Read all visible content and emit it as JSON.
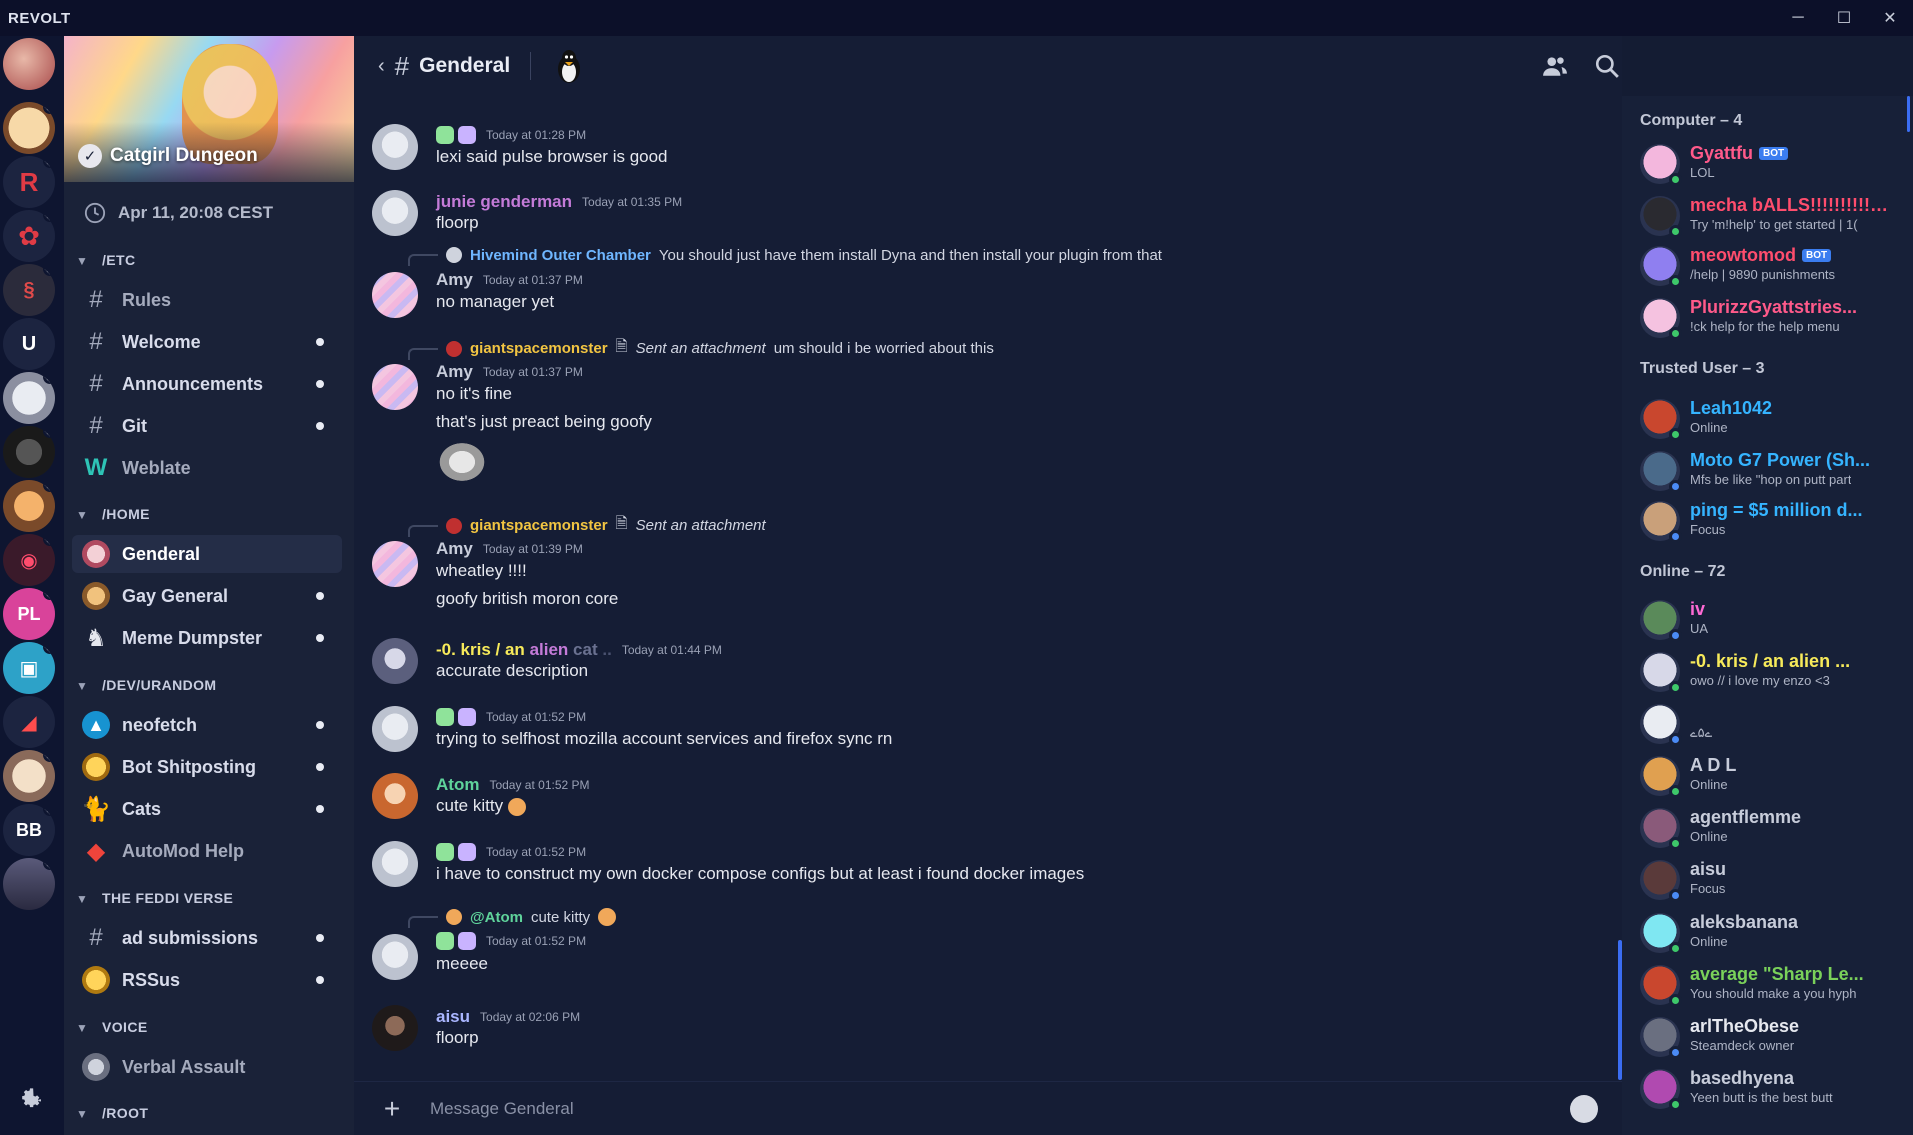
{
  "window": {
    "app_name": "REVOLT",
    "minimize": "─",
    "maximize": "☐",
    "close": "✕"
  },
  "server": {
    "name": "Catgirl Dungeon",
    "verified_mark": "✓",
    "time_label": "Apr 11, 20:08 CEST",
    "categories": [
      {
        "label": "/ETC"
      },
      {
        "label": "/HOME"
      },
      {
        "label": "/DEV/URANDOM"
      },
      {
        "label": "THE FEDDI VERSE"
      },
      {
        "label": "VOICE"
      },
      {
        "label": "/ROOT"
      }
    ],
    "channels": [
      {
        "label": "Rules",
        "icon": "hash-icon"
      },
      {
        "label": "Welcome",
        "icon": "hash-icon"
      },
      {
        "label": "Announcements",
        "icon": "hash-icon"
      },
      {
        "label": "Git",
        "icon": "hash-icon"
      },
      {
        "label": "Weblate",
        "icon": "weblate-icon"
      },
      {
        "label": "Genderal",
        "icon": "channel-avatar"
      },
      {
        "label": "Gay General",
        "icon": "channel-avatar"
      },
      {
        "label": "Meme Dumpster",
        "icon": "channel-avatar"
      },
      {
        "label": "neofetch",
        "icon": "arch-icon"
      },
      {
        "label": "Bot Shitposting",
        "icon": "channel-avatar"
      },
      {
        "label": "Cats",
        "icon": "cat-icon"
      },
      {
        "label": "AutoMod Help",
        "icon": "anydesk-icon"
      },
      {
        "label": "ad submissions",
        "icon": "hash-icon"
      },
      {
        "label": "RSSus",
        "icon": "channel-avatar"
      },
      {
        "label": "Verbal Assault",
        "icon": "voice-avatar"
      }
    ],
    "rail": [
      {
        "label": "R",
        "color": "#d9343d"
      },
      {
        "label": "U",
        "color": "#1c2440"
      },
      {
        "label": "PL",
        "color": "#d9439a"
      },
      {
        "label": "BB",
        "color": "#1c2440"
      }
    ],
    "settings_icon": "gear-icon"
  },
  "channel_header": {
    "back": "‹",
    "hash": "#",
    "name": "Genderal"
  },
  "messages": [
    {
      "author": "",
      "time": "Today at 01:28 PM",
      "lines": [
        "lexi said pulse browser is good"
      ]
    },
    {
      "author": "junie genderman",
      "time": "Today at 01:35 PM",
      "lines": [
        "floorp"
      ]
    },
    {
      "reply_to": "Hivemind Outer Chamber",
      "reply_text": "You should just have them install Dyna and then install your plugin from that",
      "author": "Amy",
      "time": "Today at 01:37 PM",
      "lines": [
        "no manager yet"
      ]
    },
    {
      "reply_to": "giantspacemonster",
      "reply_attachment": "Sent an attachment",
      "reply_text": "um should i be worried about this",
      "author": "Amy",
      "time": "Today at 01:37 PM",
      "lines": [
        "no it's fine",
        "that's just preact being goofy"
      ]
    },
    {
      "reply_to": "giantspacemonster",
      "reply_attachment": "Sent an attachment",
      "author": "Amy",
      "time": "Today at 01:39 PM",
      "lines": [
        "wheatley !!!!",
        "goofy british moron core"
      ]
    },
    {
      "author_a": "-0. kris / an",
      "author_b": "alien",
      "author_c": "cat",
      "author_d": "..",
      "time": "Today at 01:44 PM",
      "lines": [
        "accurate description"
      ]
    },
    {
      "author": "",
      "time": "Today at 01:52 PM",
      "lines": [
        "trying to selfhost mozilla account services and firefox sync rn"
      ]
    },
    {
      "author": "Atom",
      "time": "Today at 01:52 PM",
      "lines": [
        "cute kitty"
      ]
    },
    {
      "author": "",
      "time": "Today at 01:52 PM",
      "lines": [
        "i have to construct my own docker compose configs but at least i found docker images"
      ]
    },
    {
      "reply_to": "@Atom",
      "reply_text": "cute kitty",
      "author": "",
      "time": "Today at 01:52 PM",
      "lines": [
        "meeee"
      ]
    },
    {
      "author": "aisu",
      "time": "Today at 02:06 PM",
      "lines": [
        "floorp"
      ]
    }
  ],
  "composer": {
    "plus": "+",
    "placeholder": "Message Genderal"
  },
  "members": {
    "groups": [
      {
        "label": "Computer – 4"
      },
      {
        "label": "Trusted User – 3"
      },
      {
        "label": "Online – 72"
      }
    ],
    "list": [
      {
        "name": "Gyattfu",
        "bot": "BOT",
        "status": "LOL",
        "color": "#ff5a8a",
        "presence": "online"
      },
      {
        "name": "mecha bALLS!!!!!!!!!!",
        "bot": "BOT",
        "status": "Try 'm!help' to get started | 1(",
        "color": "#ff4d6d",
        "presence": "online"
      },
      {
        "name": "meowtomod",
        "bot": "BOT",
        "status": "/help | 9890 punishments",
        "color": "#ff4d6d",
        "presence": "online"
      },
      {
        "name": "PlurizzGyattstries...",
        "bot": "",
        "status": "!ck help for the help menu",
        "color": "#ff5a8a",
        "presence": "online"
      },
      {
        "name": "Leah1042",
        "bot": "",
        "status": "Online",
        "color": "#35b4ff",
        "presence": "online"
      },
      {
        "name": "Moto G7 Power (Sh...",
        "bot": "",
        "status": "Mfs be like \"hop on putt part",
        "color": "#35b4ff",
        "presence": "focus"
      },
      {
        "name": "ping = $5 million d...",
        "bot": "",
        "status": "Focus",
        "color": "#35b4ff",
        "presence": "focus"
      },
      {
        "name": "iv",
        "bot": "",
        "status": "UA",
        "color": "#ff6ad5",
        "presence": "focus"
      },
      {
        "name": "-0. kris / an alien ...",
        "bot": "",
        "status": "owo // i love my enzo <3",
        "color": "#f7ea5a",
        "presence": "online"
      },
      {
        "name": "",
        "bot": "",
        "status": "ے۵ے",
        "color": "#e6e8ef",
        "presence": "focus"
      },
      {
        "name": "A D L",
        "bot": "",
        "status": "Online",
        "color": "#c7ccda",
        "presence": "online"
      },
      {
        "name": "agentflemme",
        "bot": "",
        "status": "Online",
        "color": "#c7ccda",
        "presence": "online"
      },
      {
        "name": "aisu",
        "bot": "",
        "status": "Focus",
        "color": "#c7ccda",
        "presence": "focus"
      },
      {
        "name": "aleksbanana",
        "bot": "",
        "status": "Online",
        "color": "#c7ccda",
        "presence": "online"
      },
      {
        "name": "average \"Sharp Le...",
        "bot": "",
        "status": "You should make a you hyph",
        "color": "#7ad15a",
        "presence": "online"
      },
      {
        "name": "arlTheObese",
        "bot": "",
        "status": "Steamdeck owner",
        "color": "#e6e8ef",
        "presence": "focus"
      },
      {
        "name": "basedhyena",
        "bot": "",
        "status": "Yeen butt is the best butt",
        "color": "#c7ccda",
        "presence": "online"
      }
    ]
  },
  "colors": {
    "accent": "#3b7df0",
    "amy": "#c7ccda",
    "junie": "#c47bd8",
    "giant": "#f2c542",
    "hivemind": "#6fb6ff",
    "atom": "#5fd39b",
    "aisu": "#aab6ff",
    "online": "#3ec86a",
    "focus": "#4b8bf5"
  }
}
